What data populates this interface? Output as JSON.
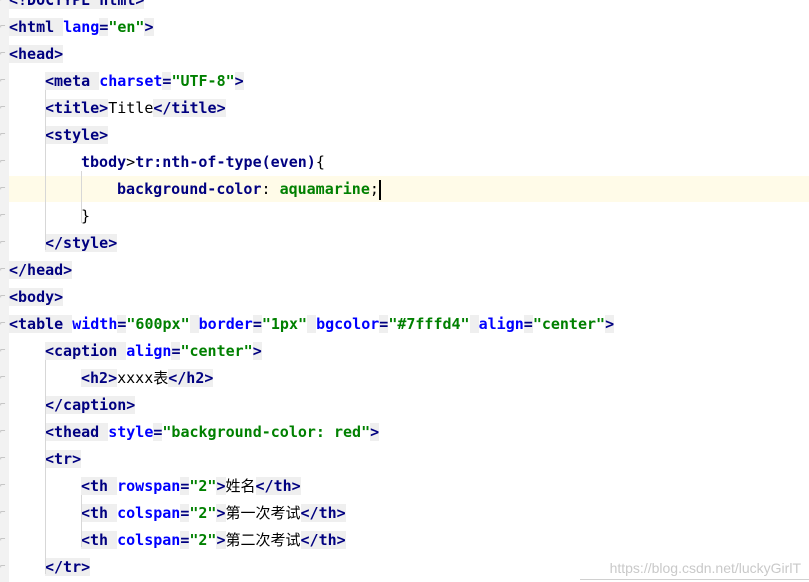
{
  "editor": {
    "lines": [
      {
        "indent": 0,
        "tokens": [
          {
            "c": "t",
            "s": "<!DOCTYPE html>"
          }
        ]
      },
      {
        "indent": 0,
        "tokens": [
          {
            "c": "t",
            "s": "<html "
          },
          {
            "c": "a",
            "s": "lang"
          },
          {
            "c": "t",
            "s": "="
          },
          {
            "c": "v",
            "s": "\"en\""
          },
          {
            "c": "t",
            "s": ">"
          }
        ]
      },
      {
        "indent": 0,
        "tokens": [
          {
            "c": "t",
            "s": "<head>"
          }
        ]
      },
      {
        "indent": 1,
        "tokens": [
          {
            "c": "t",
            "s": "<meta "
          },
          {
            "c": "a",
            "s": "charset"
          },
          {
            "c": "t",
            "s": "="
          },
          {
            "c": "v",
            "s": "\"UTF-8\""
          },
          {
            "c": "t",
            "s": ">"
          }
        ]
      },
      {
        "indent": 1,
        "tokens": [
          {
            "c": "t",
            "s": "<title>"
          },
          {
            "c": "p",
            "s": "Title"
          },
          {
            "c": "t",
            "s": "</title>"
          }
        ]
      },
      {
        "indent": 1,
        "tokens": [
          {
            "c": "t",
            "s": "<style>"
          }
        ]
      },
      {
        "indent": 2,
        "tokens": [
          {
            "c": "sel",
            "s": "tbody"
          },
          {
            "c": "p",
            "s": ">"
          },
          {
            "c": "sel",
            "s": "tr:nth-of-type(even)"
          },
          {
            "c": "p",
            "s": "{"
          }
        ]
      },
      {
        "indent": 3,
        "highlight": true,
        "caret": true,
        "tokens": [
          {
            "c": "prop",
            "s": "background-color"
          },
          {
            "c": "p",
            "s": ": "
          },
          {
            "c": "v",
            "s": "aquamarine"
          },
          {
            "c": "p",
            "s": ";"
          }
        ]
      },
      {
        "indent": 2,
        "tokens": [
          {
            "c": "p",
            "s": "}"
          }
        ]
      },
      {
        "indent": 1,
        "tokens": [
          {
            "c": "t",
            "s": "</style>"
          }
        ]
      },
      {
        "indent": 0,
        "tokens": [
          {
            "c": "t",
            "s": "</head>"
          }
        ]
      },
      {
        "indent": 0,
        "tokens": [
          {
            "c": "t",
            "s": "<body>"
          }
        ]
      },
      {
        "indent": 0,
        "tokens": [
          {
            "c": "t",
            "s": "<table "
          },
          {
            "c": "a",
            "s": "width"
          },
          {
            "c": "t",
            "s": "="
          },
          {
            "c": "v",
            "s": "\"600px\""
          },
          {
            "c": "t",
            "s": " "
          },
          {
            "c": "a",
            "s": "border"
          },
          {
            "c": "t",
            "s": "="
          },
          {
            "c": "v",
            "s": "\"1px\""
          },
          {
            "c": "t",
            "s": " "
          },
          {
            "c": "a",
            "s": "bgcolor"
          },
          {
            "c": "t",
            "s": "="
          },
          {
            "c": "v",
            "s": "\"#7fffd4\""
          },
          {
            "c": "t",
            "s": " "
          },
          {
            "c": "a",
            "s": "align"
          },
          {
            "c": "t",
            "s": "="
          },
          {
            "c": "v",
            "s": "\"center\""
          },
          {
            "c": "t",
            "s": ">"
          }
        ]
      },
      {
        "indent": 1,
        "tokens": [
          {
            "c": "t",
            "s": "<caption "
          },
          {
            "c": "a",
            "s": "align"
          },
          {
            "c": "t",
            "s": "="
          },
          {
            "c": "v",
            "s": "\"center\""
          },
          {
            "c": "t",
            "s": ">"
          }
        ]
      },
      {
        "indent": 2,
        "tokens": [
          {
            "c": "t",
            "s": "<h2>"
          },
          {
            "c": "p",
            "s": "xxxx表"
          },
          {
            "c": "t",
            "s": "</h2>"
          }
        ]
      },
      {
        "indent": 1,
        "tokens": [
          {
            "c": "t",
            "s": "</caption>"
          }
        ]
      },
      {
        "indent": 1,
        "tokens": [
          {
            "c": "t",
            "s": "<thead "
          },
          {
            "c": "a",
            "s": "style"
          },
          {
            "c": "t",
            "s": "="
          },
          {
            "c": "v",
            "s": "\"background-color: red\""
          },
          {
            "c": "t",
            "s": ">"
          }
        ]
      },
      {
        "indent": 1,
        "tokens": [
          {
            "c": "t",
            "s": "<tr>"
          }
        ]
      },
      {
        "indent": 2,
        "tokens": [
          {
            "c": "t",
            "s": "<th "
          },
          {
            "c": "a",
            "s": "rowspan"
          },
          {
            "c": "t",
            "s": "="
          },
          {
            "c": "v",
            "s": "\"2\""
          },
          {
            "c": "t",
            "s": ">"
          },
          {
            "c": "p",
            "s": "姓名"
          },
          {
            "c": "t",
            "s": "</th>"
          }
        ]
      },
      {
        "indent": 2,
        "tokens": [
          {
            "c": "t",
            "s": "<th "
          },
          {
            "c": "a",
            "s": "colspan"
          },
          {
            "c": "t",
            "s": "="
          },
          {
            "c": "v",
            "s": "\"2\""
          },
          {
            "c": "t",
            "s": ">"
          },
          {
            "c": "p",
            "s": "第一次考试"
          },
          {
            "c": "t",
            "s": "</th>"
          }
        ]
      },
      {
        "indent": 2,
        "tokens": [
          {
            "c": "t",
            "s": "<th "
          },
          {
            "c": "a",
            "s": "colspan"
          },
          {
            "c": "t",
            "s": "="
          },
          {
            "c": "v",
            "s": "\"2\""
          },
          {
            "c": "t",
            "s": ">"
          },
          {
            "c": "p",
            "s": "第二次考试"
          },
          {
            "c": "t",
            "s": "</th>"
          }
        ]
      },
      {
        "indent": 1,
        "tokens": [
          {
            "c": "t",
            "s": "</tr>"
          }
        ]
      }
    ]
  },
  "watermark": "https://blog.csdn.net/luckyGirlT"
}
